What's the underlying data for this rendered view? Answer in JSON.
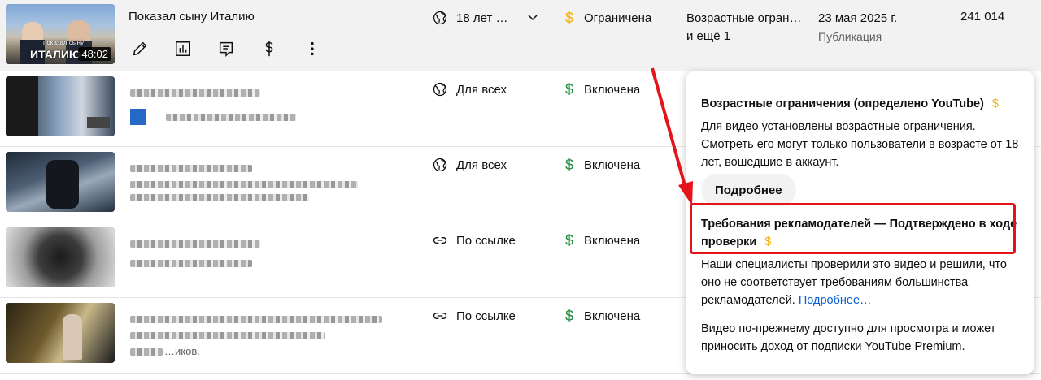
{
  "rows": [
    {
      "title": "Показал сыну Италию",
      "duration": "48:02",
      "thumb_caption": "ИТАЛИЮ",
      "thumb_caption_small": "показал сыну",
      "visibility": "18 лет …",
      "visibility_icon": "globe-icon",
      "monetization": "Ограничена",
      "monetization_color": "#f2b311",
      "restrictions_line1": "Возрастные огран…",
      "restrictions_line2": "и ещё 1",
      "date": "23 мая 2025 г.",
      "date_sub": "Публикация",
      "views": "241 014"
    },
    {
      "title": "",
      "visibility": "Для всех",
      "visibility_icon": "globe-icon",
      "monetization": "Включена",
      "monetization_color": "#1e8e3e"
    },
    {
      "title": "",
      "visibility": "Для всех",
      "visibility_icon": "globe-icon",
      "monetization": "Включена",
      "monetization_color": "#1e8e3e"
    },
    {
      "title": "",
      "visibility": "По ссылке",
      "visibility_icon": "link-icon",
      "monetization": "Включена",
      "monetization_color": "#1e8e3e"
    },
    {
      "title": "",
      "visibility": "По ссылке",
      "visibility_icon": "link-icon",
      "monetization": "Включена",
      "monetization_color": "#1e8e3e",
      "desc_tail": "…иков."
    }
  ],
  "tools": [
    "pencil-icon",
    "bar-chart-icon",
    "comments-icon",
    "dollar-icon",
    "more-vert-icon"
  ],
  "popup": {
    "section1_title": "Возрастные ограничения (определено YouTube)",
    "section1_text": "Для видео установлены возрастные ограничения. Смотреть его могут только пользователи в возрасте от 18 лет, вошедшие в аккаунт.",
    "more_button": "Подробнее",
    "section2_title": "Требования рекламодателей — Подтверждено в ходе проверки",
    "section2_text": "Наши специалисты проверили это видео и решили, что оно не соответствует требованиям большинства рекламодателей.",
    "section2_link": "Подробнее…",
    "section3_text": "Видео по-прежнему доступно для просмотра и может приносить доход от подписки YouTube Premium.",
    "dollar_symbol": "$"
  },
  "colors": {
    "highlight": "#e3141a",
    "link": "#065fd4",
    "limited": "#f2b311",
    "on": "#1e8e3e"
  }
}
